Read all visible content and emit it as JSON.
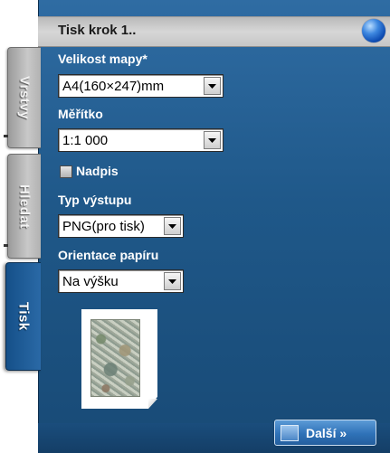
{
  "panel": {
    "title": "Tisk krok 1..",
    "title_icon": "globe-icon"
  },
  "tabs": [
    {
      "label": "Vrstvy",
      "active": false
    },
    {
      "label": "Hledat",
      "active": false
    },
    {
      "label": "Tisk",
      "active": true
    }
  ],
  "form": {
    "map_size": {
      "label": "Velikost mapy*",
      "value": "A4(160×247)mm"
    },
    "scale": {
      "label": "Měřítko",
      "value": "1:1 000"
    },
    "heading_checkbox": {
      "label": "Nadpis",
      "checked": false
    },
    "output_type": {
      "label": "Typ výstupu",
      "value": "PNG(pro tisk)"
    },
    "orientation": {
      "label": "Orientace papíru",
      "value": "Na výšku"
    }
  },
  "footer": {
    "next_label": "Další »"
  },
  "colors": {
    "panel_background": "#1f5889",
    "titlebar_background": "#c7c7c7",
    "active_tab": "#2a69a6",
    "inactive_tab": "#b2b2b2"
  }
}
